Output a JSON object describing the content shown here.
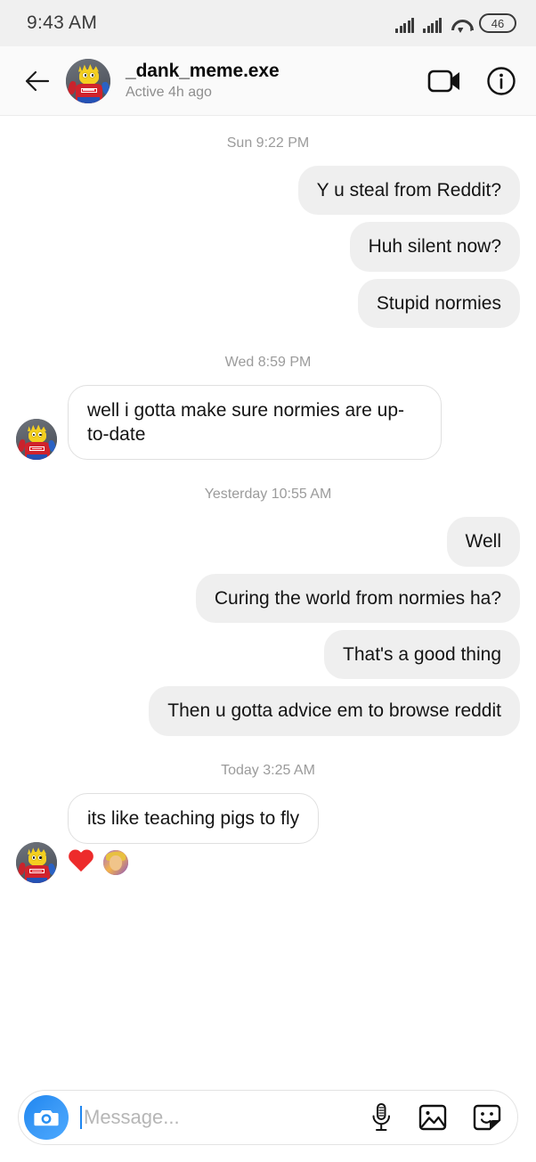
{
  "status_bar": {
    "time": "9:43 AM",
    "battery_level": "46",
    "signal_icon": "cellular-signal-icon",
    "signal2_icon": "cellular-signal-2-icon",
    "wifi_icon": "wifi-icon",
    "battery_icon": "battery-icon"
  },
  "header": {
    "back_icon": "back-arrow-icon",
    "avatar_alt": "bart-simpson-avatar",
    "title": "_dank_meme.exe",
    "subtitle": "Active 4h ago",
    "video_icon": "video-camera-icon",
    "info_icon": "info-circle-icon"
  },
  "thread": {
    "groups": [
      {
        "timestamp": "Sun 9:22 PM",
        "messages": [
          {
            "side": "out",
            "text": "Y u steal from Reddit?"
          },
          {
            "side": "out",
            "text": "Huh silent now?"
          },
          {
            "side": "out",
            "text": "Stupid normies"
          }
        ]
      },
      {
        "timestamp": "Wed 8:59 PM",
        "messages": [
          {
            "side": "in",
            "text": "well i gotta make sure normies are up-to-date",
            "avatar": true
          }
        ]
      },
      {
        "timestamp": "Yesterday 10:55 AM",
        "messages": [
          {
            "side": "out",
            "text": "Well"
          },
          {
            "side": "out",
            "text": "Curing the world from normies ha?"
          },
          {
            "side": "out",
            "text": "That's a good thing"
          },
          {
            "side": "out",
            "text": "Then u gotta advice em to browse reddit"
          }
        ]
      },
      {
        "timestamp": "Today 3:25 AM",
        "messages": [
          {
            "side": "in",
            "text": "its like teaching pigs to fly",
            "avatar": true,
            "reaction": "heart"
          }
        ]
      }
    ],
    "reaction": {
      "emoji_name": "red-heart-emoji",
      "reactor_avatar_alt": "reactor-avatar"
    }
  },
  "composer": {
    "camera_icon": "camera-icon",
    "placeholder": "Message...",
    "value": "",
    "mic_icon": "microphone-icon",
    "gallery_icon": "gallery-icon",
    "sticker_icon": "sticker-icon"
  },
  "colors": {
    "outgoing_bubble": "#efefef",
    "incoming_bubble": "#ffffff",
    "incoming_border": "#e0e0e0",
    "accent_blue": "#1f86f0",
    "heart_red": "#ed2b2b",
    "muted_text": "#9b9b9b",
    "status_bar_bg": "#f0f0f0"
  }
}
